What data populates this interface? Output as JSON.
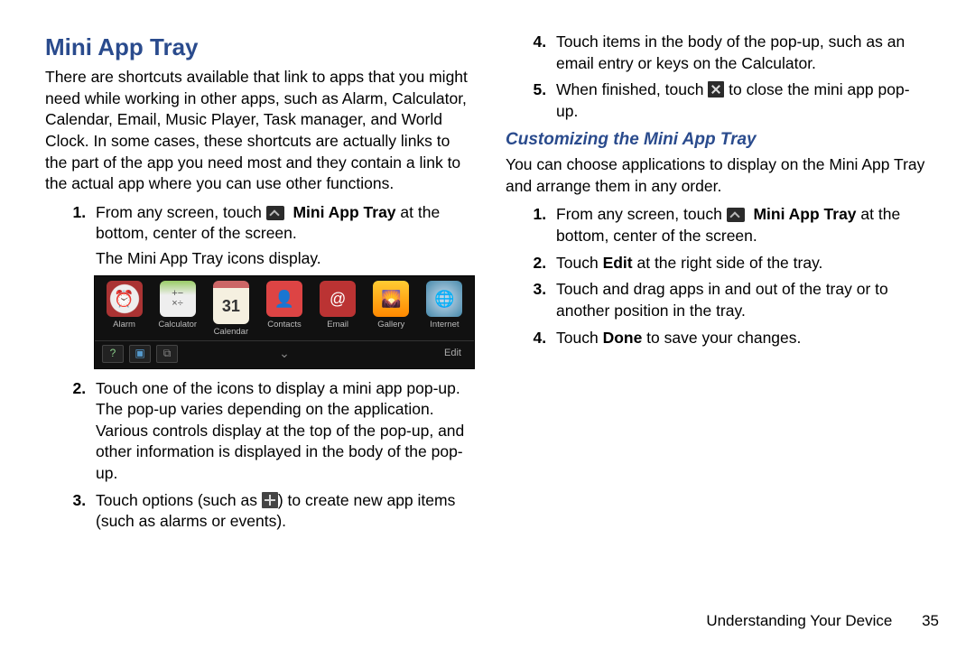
{
  "left": {
    "heading": "Mini App Tray",
    "intro": "There are shortcuts available that link to apps that you might need while working in other apps, such as Alarm, Calculator, Calendar, Email, Music Player, Task manager, and World Clock. In some cases, these shortcuts are actually links to the part of the app you need most and they contain a link to the actual app where you can use other functions.",
    "step1_a": "From any screen, touch ",
    "step1_b": "Mini App Tray",
    "step1_c": " at the bottom, center of the screen.",
    "step1_sub": "The Mini App Tray icons display.",
    "tray_apps": [
      {
        "label": "Alarm"
      },
      {
        "label": "Calculator"
      },
      {
        "label": "Calendar"
      },
      {
        "label": "Contacts"
      },
      {
        "label": "Email"
      },
      {
        "label": "Gallery"
      },
      {
        "label": "Internet"
      }
    ],
    "tray_edit": "Edit",
    "tray_cal_day": "31",
    "step2": "Touch one of the icons to display a mini app pop-up. The pop-up varies depending on the application. Various controls display at the top of the pop-up, and other information is displayed in the body of the pop-up.",
    "step3_a": "Touch options (such as ",
    "step3_b": ") to create new app items (such as alarms or events)."
  },
  "right": {
    "step4": "Touch items in the body of the pop-up, such as an email entry or keys on the Calculator.",
    "step5_a": "When finished, touch ",
    "step5_b": " to close the mini app pop-up.",
    "subheading": "Customizing the Mini App Tray",
    "intro2": "You can choose applications to display on the Mini App Tray and arrange them in any order.",
    "c1_a": "From any screen, touch ",
    "c1_b": "Mini App Tray",
    "c1_c": " at the bottom, center of the screen.",
    "c2_a": "Touch ",
    "c2_b": "Edit",
    "c2_c": " at the right side of the tray.",
    "c3": "Touch and drag apps in and out of the tray or to another position in the tray.",
    "c4_a": "Touch ",
    "c4_b": "Done",
    "c4_c": " to save your changes."
  },
  "footer": {
    "chapter": "Understanding Your Device",
    "page": "35"
  }
}
